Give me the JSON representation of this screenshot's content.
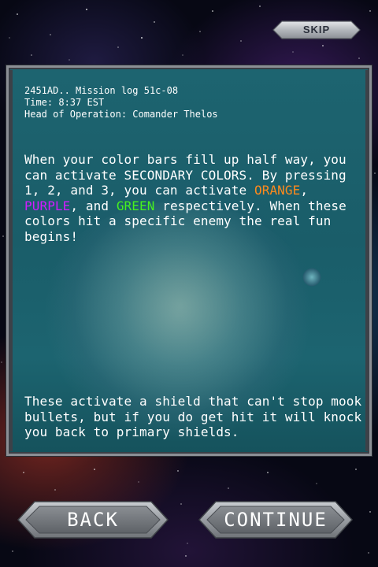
{
  "header": {
    "skip_label": "SKIP"
  },
  "log": {
    "line1": "2451AD.. Mission log 51c-08",
    "line2": "Time: 8:37 EST",
    "line3": "Head of Operation: Comander Thelos",
    "para1": {
      "part1": "When your color bars fill up half way, you can activate SECONDARY COLORS. By pressing 1, 2, and 3, you can activate ",
      "orange": "ORANGE",
      "sep1": ", ",
      "purple": "PURPLE",
      "sep2": ", and ",
      "green": "GREEN",
      "part2": " respectively. When these colors hit a specific enemy the real fun begins!"
    },
    "para2": "These activate a shield that can't stop mook bullets, but if you do get hit it will knock you back to primary shields."
  },
  "colors": {
    "orange": "#ff8a1c",
    "purple": "#d21bff",
    "green": "#46f21e",
    "panel_teal": "#1a5d69",
    "button_metal": "#a9adb2"
  },
  "footer": {
    "back_label": "BACK",
    "continue_label": "CONTINUE"
  }
}
